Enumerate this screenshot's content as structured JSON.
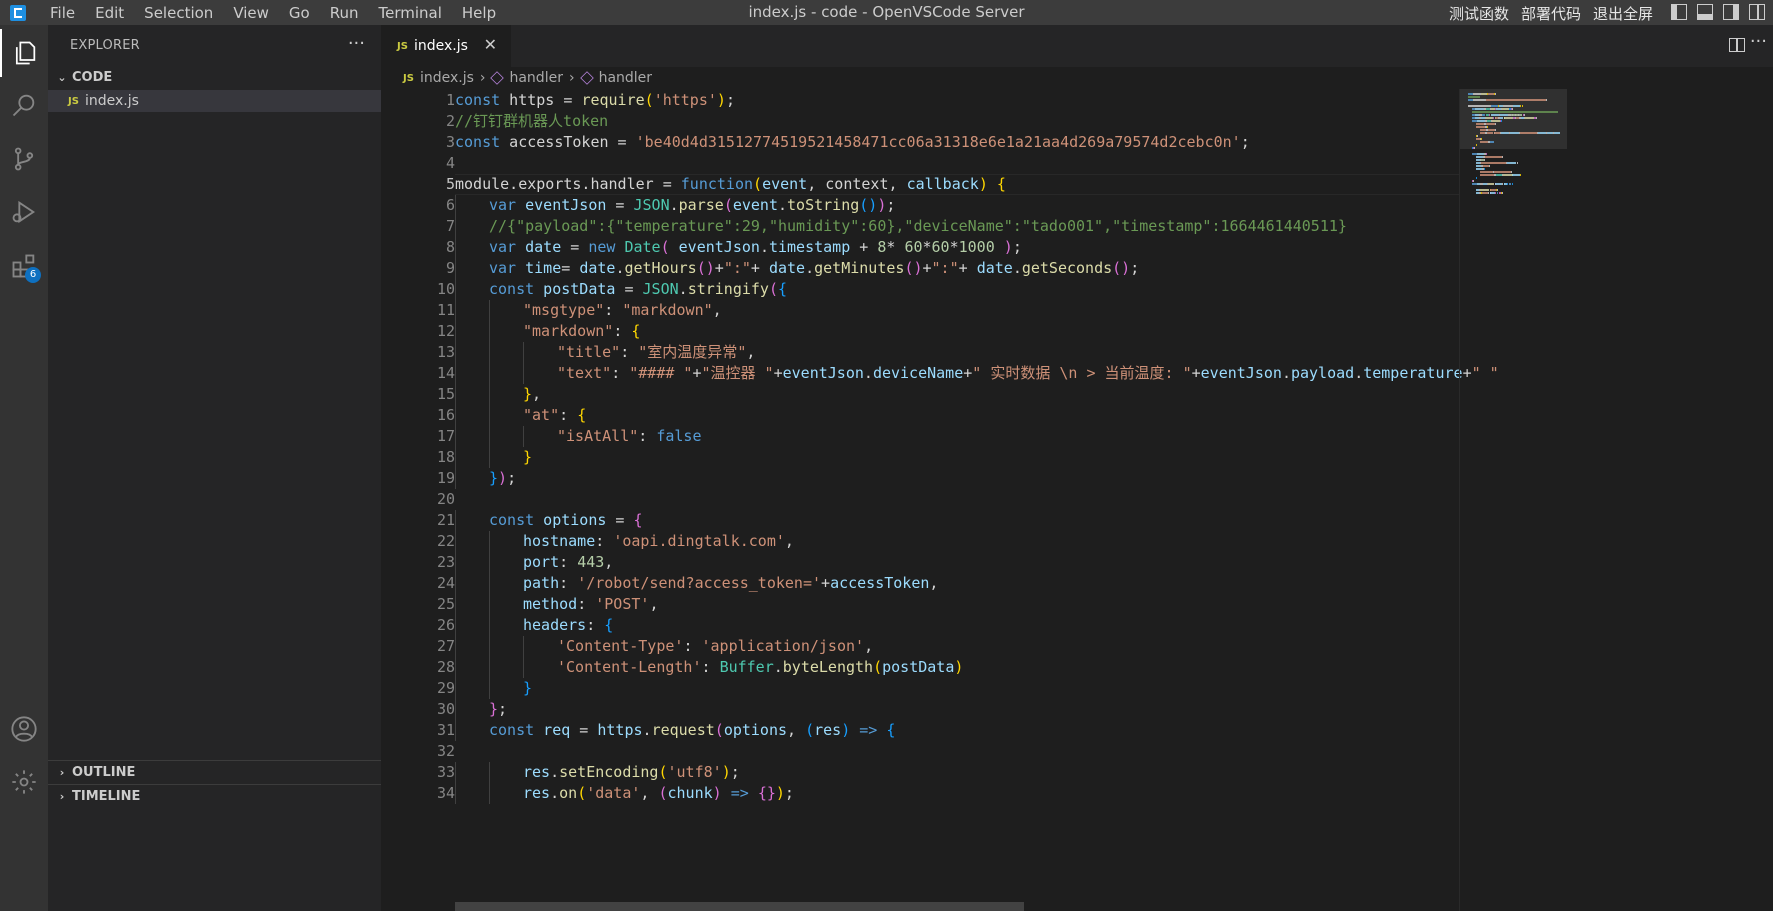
{
  "titlebar": {
    "menu": [
      "File",
      "Edit",
      "Selection",
      "View",
      "Go",
      "Run",
      "Terminal",
      "Help"
    ],
    "title": "index.js - code - OpenVSCode Server",
    "actions": [
      "测试函数",
      "部署代码",
      "退出全屏"
    ]
  },
  "activity": {
    "items": [
      "explorer-icon",
      "search-icon",
      "source-control-icon",
      "run-debug-icon",
      "extensions-icon"
    ],
    "extensions_badge": "6",
    "bottom": [
      "account-icon",
      "settings-gear-icon"
    ]
  },
  "sidebar": {
    "header": "EXPLORER",
    "more": "···",
    "folder": "CODE",
    "files": [
      {
        "icon": "JS",
        "name": "index.js"
      }
    ],
    "outline": "OUTLINE",
    "timeline": "TIMELINE"
  },
  "editor": {
    "tab": {
      "icon": "JS",
      "label": "index.js",
      "close": "✕"
    },
    "breadcrumb": [
      "index.js",
      "handler",
      "handler"
    ],
    "current_line": 5,
    "lines": [
      {
        "n": "1",
        "indent": 0,
        "tokens": [
          [
            "k",
            "const"
          ],
          [
            "p",
            " https = "
          ],
          [
            "f",
            "require"
          ],
          [
            "b1",
            "("
          ],
          [
            "s",
            "'https'"
          ],
          [
            "b1",
            ")"
          ],
          [
            "p",
            ";"
          ]
        ]
      },
      {
        "n": "2",
        "indent": 0,
        "tokens": [
          [
            "c",
            "//钉钉群机器人token"
          ]
        ]
      },
      {
        "n": "3",
        "indent": 0,
        "tokens": [
          [
            "k",
            "const"
          ],
          [
            "p",
            " accessToken = "
          ],
          [
            "s",
            "'be40d4d31512774519521458471cc06a31318e6e1a21aa4d269a79574d2cebc0n'"
          ],
          [
            "p",
            ";"
          ]
        ]
      },
      {
        "n": "4",
        "indent": 0,
        "tokens": []
      },
      {
        "n": "5",
        "indent": 0,
        "tokens": [
          [
            "p",
            "module.exports.handler = "
          ],
          [
            "k",
            "function"
          ],
          [
            "b1",
            "("
          ],
          [
            "v",
            "event"
          ],
          [
            "p",
            ", "
          ],
          [
            "p",
            "context"
          ],
          [
            "p",
            ", "
          ],
          [
            "v",
            "callback"
          ],
          [
            "b1",
            ")"
          ],
          [
            "p",
            " "
          ],
          [
            "b1",
            "{"
          ]
        ]
      },
      {
        "n": "6",
        "indent": 1,
        "tokens": [
          [
            "k",
            "var"
          ],
          [
            "v",
            " eventJson"
          ],
          [
            "p",
            " = "
          ],
          [
            "y",
            "JSON"
          ],
          [
            "p",
            "."
          ],
          [
            "f",
            "parse"
          ],
          [
            "b2",
            "("
          ],
          [
            "v",
            "event"
          ],
          [
            "p",
            "."
          ],
          [
            "f",
            "toString"
          ],
          [
            "b3",
            "()"
          ],
          [
            "b2",
            ")"
          ],
          [
            "p",
            ";"
          ]
        ]
      },
      {
        "n": "7",
        "indent": 1,
        "tokens": [
          [
            "c",
            "//{\"payload\":{\"temperature\":29,\"humidity\":60},\"deviceName\":\"tado001\",\"timestamp\":1664461440511}"
          ]
        ]
      },
      {
        "n": "8",
        "indent": 1,
        "tokens": [
          [
            "k",
            "var"
          ],
          [
            "v",
            " date"
          ],
          [
            "p",
            " = "
          ],
          [
            "k",
            "new"
          ],
          [
            "p",
            " "
          ],
          [
            "y",
            "Date"
          ],
          [
            "b2",
            "("
          ],
          [
            "p",
            " "
          ],
          [
            "v",
            "eventJson"
          ],
          [
            "p",
            "."
          ],
          [
            "v",
            "timestamp"
          ],
          [
            "p",
            " + "
          ],
          [
            "n",
            "8"
          ],
          [
            "p",
            "* "
          ],
          [
            "n",
            "60"
          ],
          [
            "p",
            "*"
          ],
          [
            "n",
            "60"
          ],
          [
            "p",
            "*"
          ],
          [
            "n",
            "1000"
          ],
          [
            "p",
            " "
          ],
          [
            "b2",
            ")"
          ],
          [
            "p",
            ";"
          ]
        ]
      },
      {
        "n": "9",
        "indent": 1,
        "tokens": [
          [
            "k",
            "var"
          ],
          [
            "v",
            " time"
          ],
          [
            "p",
            "= "
          ],
          [
            "v",
            "date"
          ],
          [
            "p",
            "."
          ],
          [
            "f",
            "getHours"
          ],
          [
            "b2",
            "()"
          ],
          [
            "p",
            "+"
          ],
          [
            "s",
            "\":\""
          ],
          [
            "p",
            "+ "
          ],
          [
            "v",
            "date"
          ],
          [
            "p",
            "."
          ],
          [
            "f",
            "getMinutes"
          ],
          [
            "b2",
            "()"
          ],
          [
            "p",
            "+"
          ],
          [
            "s",
            "\":\""
          ],
          [
            "p",
            "+ "
          ],
          [
            "v",
            "date"
          ],
          [
            "p",
            "."
          ],
          [
            "f",
            "getSeconds"
          ],
          [
            "b2",
            "()"
          ],
          [
            "p",
            ";"
          ]
        ]
      },
      {
        "n": "10",
        "indent": 1,
        "tokens": [
          [
            "k",
            "const"
          ],
          [
            "v",
            " postData"
          ],
          [
            "p",
            " = "
          ],
          [
            "y",
            "JSON"
          ],
          [
            "p",
            "."
          ],
          [
            "f",
            "stringify"
          ],
          [
            "b2",
            "("
          ],
          [
            "b3",
            "{"
          ]
        ]
      },
      {
        "n": "11",
        "indent": 2,
        "tokens": [
          [
            "s",
            "\"msgtype\""
          ],
          [
            "p",
            ": "
          ],
          [
            "s",
            "\"markdown\""
          ],
          [
            "p",
            ","
          ]
        ]
      },
      {
        "n": "12",
        "indent": 2,
        "tokens": [
          [
            "s",
            "\"markdown\""
          ],
          [
            "p",
            ": "
          ],
          [
            "b1",
            "{"
          ]
        ]
      },
      {
        "n": "13",
        "indent": 3,
        "tokens": [
          [
            "s",
            "\"title\""
          ],
          [
            "p",
            ": "
          ],
          [
            "s",
            "\"室内温度异常\""
          ],
          [
            "p",
            ","
          ]
        ]
      },
      {
        "n": "14",
        "indent": 3,
        "tokens": [
          [
            "s",
            "\"text\""
          ],
          [
            "p",
            ": "
          ],
          [
            "s",
            "\"#### \""
          ],
          [
            "p",
            "+"
          ],
          [
            "s",
            "\"温控器 \""
          ],
          [
            "p",
            "+"
          ],
          [
            "v",
            "eventJson"
          ],
          [
            "p",
            "."
          ],
          [
            "v",
            "deviceName"
          ],
          [
            "p",
            "+"
          ],
          [
            "s",
            "\" 实时数据 \\n > 当前温度: \""
          ],
          [
            "p",
            "+"
          ],
          [
            "v",
            "eventJson"
          ],
          [
            "p",
            "."
          ],
          [
            "v",
            "payload"
          ],
          [
            "p",
            "."
          ],
          [
            "v",
            "temperature"
          ],
          [
            "p",
            "+"
          ],
          [
            "s",
            "\" \""
          ]
        ]
      },
      {
        "n": "15",
        "indent": 2,
        "tokens": [
          [
            "b1",
            "}"
          ],
          [
            "p",
            ","
          ]
        ]
      },
      {
        "n": "16",
        "indent": 2,
        "tokens": [
          [
            "s",
            "\"at\""
          ],
          [
            "p",
            ": "
          ],
          [
            "b1",
            "{"
          ]
        ]
      },
      {
        "n": "17",
        "indent": 3,
        "tokens": [
          [
            "s",
            "\"isAtAll\""
          ],
          [
            "p",
            ": "
          ],
          [
            "k",
            "false"
          ]
        ]
      },
      {
        "n": "18",
        "indent": 2,
        "tokens": [
          [
            "b1",
            "}"
          ]
        ]
      },
      {
        "n": "19",
        "indent": 1,
        "tokens": [
          [
            "b3",
            "}"
          ],
          [
            "b2",
            ")"
          ],
          [
            "p",
            ";"
          ]
        ]
      },
      {
        "n": "20",
        "indent": 0,
        "tokens": []
      },
      {
        "n": "21",
        "indent": 1,
        "tokens": [
          [
            "k",
            "const"
          ],
          [
            "v",
            " options"
          ],
          [
            "p",
            " = "
          ],
          [
            "b2",
            "{"
          ]
        ]
      },
      {
        "n": "22",
        "indent": 2,
        "tokens": [
          [
            "v",
            "hostname"
          ],
          [
            "p",
            ": "
          ],
          [
            "s",
            "'oapi.dingtalk.com'"
          ],
          [
            "p",
            ","
          ]
        ]
      },
      {
        "n": "23",
        "indent": 2,
        "tokens": [
          [
            "v",
            "port"
          ],
          [
            "p",
            ": "
          ],
          [
            "n",
            "443"
          ],
          [
            "p",
            ","
          ]
        ]
      },
      {
        "n": "24",
        "indent": 2,
        "tokens": [
          [
            "v",
            "path"
          ],
          [
            "p",
            ": "
          ],
          [
            "s",
            "'/robot/send?access_token='"
          ],
          [
            "p",
            "+"
          ],
          [
            "v",
            "accessToken"
          ],
          [
            "p",
            ","
          ]
        ]
      },
      {
        "n": "25",
        "indent": 2,
        "tokens": [
          [
            "v",
            "method"
          ],
          [
            "p",
            ": "
          ],
          [
            "s",
            "'POST'"
          ],
          [
            "p",
            ","
          ]
        ]
      },
      {
        "n": "26",
        "indent": 2,
        "tokens": [
          [
            "v",
            "headers"
          ],
          [
            "p",
            ": "
          ],
          [
            "b3",
            "{"
          ]
        ]
      },
      {
        "n": "27",
        "indent": 3,
        "tokens": [
          [
            "s",
            "'Content-Type'"
          ],
          [
            "p",
            ": "
          ],
          [
            "s",
            "'application/json'"
          ],
          [
            "p",
            ","
          ]
        ]
      },
      {
        "n": "28",
        "indent": 3,
        "tokens": [
          [
            "s",
            "'Content-Length'"
          ],
          [
            "p",
            ": "
          ],
          [
            "y",
            "Buffer"
          ],
          [
            "p",
            "."
          ],
          [
            "f",
            "byteLength"
          ],
          [
            "b1",
            "("
          ],
          [
            "v",
            "postData"
          ],
          [
            "b1",
            ")"
          ]
        ]
      },
      {
        "n": "29",
        "indent": 2,
        "tokens": [
          [
            "b3",
            "}"
          ]
        ]
      },
      {
        "n": "30",
        "indent": 1,
        "tokens": [
          [
            "b2",
            "}"
          ],
          [
            "p",
            ";"
          ]
        ]
      },
      {
        "n": "31",
        "indent": 1,
        "tokens": [
          [
            "k",
            "const"
          ],
          [
            "v",
            " req"
          ],
          [
            "p",
            " = "
          ],
          [
            "v",
            "https"
          ],
          [
            "p",
            "."
          ],
          [
            "f",
            "request"
          ],
          [
            "b2",
            "("
          ],
          [
            "v",
            "options"
          ],
          [
            "p",
            ", "
          ],
          [
            "b3",
            "("
          ],
          [
            "v",
            "res"
          ],
          [
            "b3",
            ")"
          ],
          [
            "p",
            " "
          ],
          [
            "k",
            "=>"
          ],
          [
            "p",
            " "
          ],
          [
            "b3",
            "{"
          ]
        ]
      },
      {
        "n": "32",
        "indent": 0,
        "tokens": []
      },
      {
        "n": "33",
        "indent": 2,
        "tokens": [
          [
            "v",
            "res"
          ],
          [
            "p",
            "."
          ],
          [
            "f",
            "setEncoding"
          ],
          [
            "b1",
            "("
          ],
          [
            "s",
            "'utf8'"
          ],
          [
            "b1",
            ")"
          ],
          [
            "p",
            ";"
          ]
        ]
      },
      {
        "n": "34",
        "indent": 2,
        "tokens": [
          [
            "v",
            "res"
          ],
          [
            "p",
            "."
          ],
          [
            "f",
            "on"
          ],
          [
            "b1",
            "("
          ],
          [
            "s",
            "'data'"
          ],
          [
            "p",
            ", "
          ],
          [
            "b2",
            "("
          ],
          [
            "v",
            "chunk"
          ],
          [
            "b2",
            ")"
          ],
          [
            "p",
            " "
          ],
          [
            "k",
            "=>"
          ],
          [
            "p",
            " "
          ],
          [
            "b2",
            "{}"
          ],
          [
            "b1",
            ")"
          ],
          [
            "p",
            ";"
          ]
        ]
      }
    ]
  },
  "colors": {
    "keyword": "#569cd6",
    "string": "#ce9178",
    "comment": "#6a9955",
    "variable": "#9cdcfe",
    "function": "#dcdcaa",
    "number": "#b5cea8",
    "type": "#4ec9b0",
    "bracket1": "#ffd700",
    "bracket2": "#da70d6",
    "bracket3": "#179fff"
  }
}
